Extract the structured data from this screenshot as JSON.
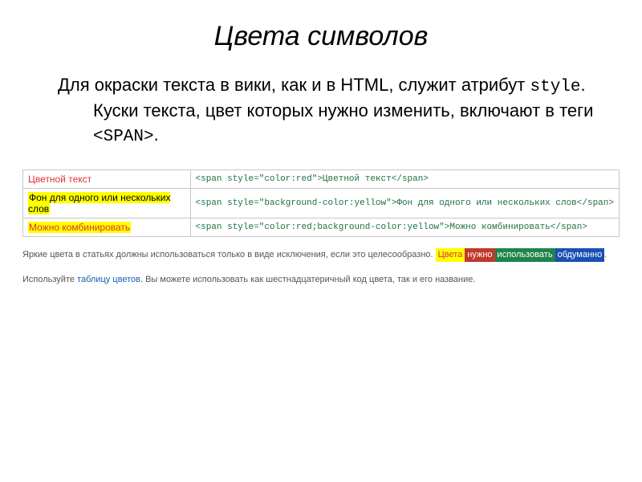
{
  "title": "Цвета символов",
  "paragraph": {
    "p1a": "Для окраски текста в вики, как и в HTML, служит атрибут ",
    "p1_mono1": "style",
    "p1b": ". Куски текста, цвет которых нужно изменить, включают в теги ",
    "p1_mono2": "<SPAN>",
    "p1c": "."
  },
  "table": {
    "row1": {
      "display": "Цветной текст",
      "code": "<span style=\"color:red\">Цветной текст</span>"
    },
    "row2": {
      "display": "Фон для одного или нескольких слов",
      "code": "<span style=\"background-color:yellow\">Фон для одного или нескольких слов</span>"
    },
    "row3": {
      "display": "Можно комбинировать",
      "code": "<span style=\"color:red;background-color:yellow\">Можно комбинировать</span>"
    }
  },
  "note1": {
    "a": "Яркие цвета в статьях должны использоваться только в виде исключения, если это целесообразно. ",
    "chip1": "Цвета",
    "chip2": "нужно",
    "chip3": "использовать",
    "chip4": "обдуманно",
    "b": "."
  },
  "note2": {
    "a": "Используйте ",
    "link": "таблицу цветов",
    "b": ". Вы можете использовать как шестнадцатеричный код цвета, так и его название."
  }
}
